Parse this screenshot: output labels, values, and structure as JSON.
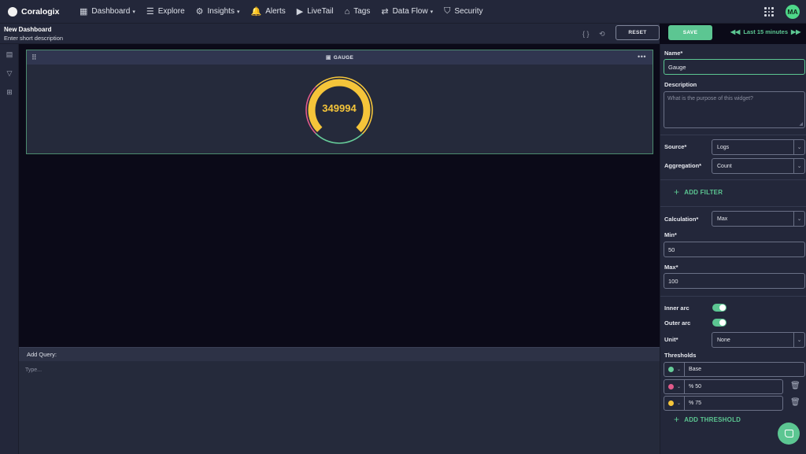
{
  "brand": {
    "name": "Coralogix"
  },
  "nav": {
    "items": [
      {
        "label": "Dashboard",
        "icon": "dashboard-icon",
        "glyph": "▦",
        "caret": true
      },
      {
        "label": "Explore",
        "icon": "explore-icon",
        "glyph": "☰",
        "caret": false
      },
      {
        "label": "Insights",
        "icon": "insights-icon",
        "glyph": "⚙",
        "caret": true
      },
      {
        "label": "Alerts",
        "icon": "bell-icon",
        "glyph": "🔔",
        "caret": false
      },
      {
        "label": "LiveTail",
        "icon": "play-icon",
        "glyph": "▶",
        "caret": false
      },
      {
        "label": "Tags",
        "icon": "tag-icon",
        "glyph": "⌂",
        "caret": false
      },
      {
        "label": "Data Flow",
        "icon": "data-flow-icon",
        "glyph": "⇄",
        "caret": true
      },
      {
        "label": "Security",
        "icon": "shield-icon",
        "glyph": "⛉",
        "caret": false
      }
    ],
    "user_initials": "MA"
  },
  "header": {
    "title": "New Dashboard",
    "description": "Enter short description",
    "reset_label": "RESET",
    "save_label": "SAVE",
    "time_range": "Last 15 minutes"
  },
  "widget": {
    "title": "GAUGE",
    "value": "349994",
    "arc_fill": 1.0
  },
  "query": {
    "header": "Add Query:",
    "placeholder": "Type..."
  },
  "panel": {
    "name_label": "Name*",
    "name_value": "Gauge",
    "description_label": "Description",
    "description_placeholder": "What is the purpose of this widget?",
    "source_label": "Source*",
    "source_value": "Logs",
    "aggregation_label": "Aggregation*",
    "aggregation_value": "Count",
    "add_filter_label": "ADD FILTER",
    "calculation_label": "Calculation*",
    "calculation_value": "Max",
    "min_label": "Min*",
    "min_value": "50",
    "max_label": "Max*",
    "max_value": "100",
    "inner_arc_label": "Inner arc",
    "inner_arc_on": true,
    "outer_arc_label": "Outer arc",
    "outer_arc_on": true,
    "unit_label": "Unit*",
    "unit_value": "None",
    "thresholds_label": "Thresholds",
    "thresholds": [
      {
        "label": "Base",
        "color": "#66cc99"
      },
      {
        "label": "% 50",
        "color": "#e05a8a"
      },
      {
        "label": "% 75",
        "color": "#f5c53a"
      }
    ],
    "add_threshold_label": "ADD THRESHOLD"
  },
  "colors": {
    "accent": "#5cc692",
    "gauge_value": "#f5c53a",
    "threshold_low": "#66cc99",
    "threshold_mid": "#e05a8a",
    "threshold_high": "#f5c53a"
  }
}
